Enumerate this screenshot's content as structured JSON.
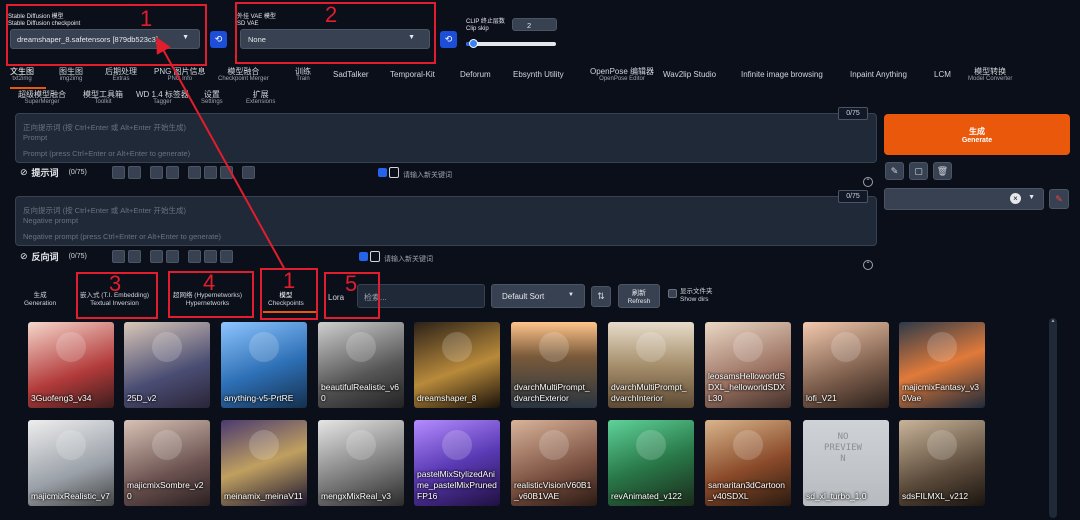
{
  "top": {
    "sd_model_label": "Stable Diffusion 模型",
    "sd_model_sublabel": "Stable Diffusion checkpoint",
    "sd_model_value": "dreamshaper_8.safetensors [879db523c3]",
    "vae_label": "外挂 VAE 模型",
    "vae_sublabel": "SD VAE",
    "vae_value": "None",
    "clip_label": "CLIP 终止层数",
    "clip_sublabel": "Clip skip",
    "clip_value": "2",
    "clip_fraction": 0.08
  },
  "tabs_row1": [
    {
      "label": "文生图",
      "sub": "txt2img"
    },
    {
      "label": "图生图",
      "sub": "img2img"
    },
    {
      "label": "后期处理",
      "sub": "Extras"
    },
    {
      "label": "PNG 图片信息",
      "sub": "PNG Info"
    },
    {
      "label": "模型融合",
      "sub": "Checkpoint Merger"
    },
    {
      "label": "训练",
      "sub": "Train"
    },
    {
      "label": "SadTalker",
      "sub": ""
    },
    {
      "label": "Temporal-Kit",
      "sub": ""
    },
    {
      "label": "Deforum",
      "sub": ""
    },
    {
      "label": "Ebsynth Utility",
      "sub": ""
    },
    {
      "label": "OpenPose 编辑器",
      "sub": "OpenPose Editor"
    },
    {
      "label": "Wav2lip Studio",
      "sub": ""
    },
    {
      "label": "Infinite image browsing",
      "sub": ""
    },
    {
      "label": "Inpaint Anything",
      "sub": ""
    },
    {
      "label": "LCM",
      "sub": ""
    },
    {
      "label": "模型转换",
      "sub": "Model Converter"
    }
  ],
  "tabs_row2": [
    {
      "label": "超级模型融合",
      "sub": "SuperMerger"
    },
    {
      "label": "模型工具箱",
      "sub": "Toolkit"
    },
    {
      "label": "WD 1.4 标签器",
      "sub": "Tagger"
    },
    {
      "label": "设置",
      "sub": "Settings"
    },
    {
      "label": "扩展",
      "sub": "Extensions"
    }
  ],
  "prompt": {
    "counter": "0/75",
    "placeholder_1": "正向提示词 (按 Ctrl+Enter 或 Alt+Enter 开始生成)",
    "placeholder_2": "Prompt",
    "placeholder_3": "Prompt (press Ctrl+Enter or Alt+Enter to generate)",
    "toolbar_label": "提示词",
    "toolbar_count": "(0/75)",
    "keyword_placeholder": "请输入新关键词"
  },
  "negative": {
    "counter": "0/75",
    "placeholder_1": "反向提示词 (按 Ctrl+Enter 或 Alt+Enter 开始生成)",
    "placeholder_2": "Negative prompt",
    "placeholder_3": "Negative prompt (press Ctrl+Enter or Alt+Enter to generate)",
    "toolbar_label": "反向词",
    "toolbar_count": "(0/75)",
    "keyword_placeholder": "请输入新关键词"
  },
  "generate": {
    "label": "生成",
    "sub": "Generate"
  },
  "extra_tabs": [
    {
      "label": "生成",
      "sub": "Generation"
    },
    {
      "label": "嵌入式 (T.I. Embedding)",
      "sub": "Textual Inversion"
    },
    {
      "label": "超网络 (Hypernetworks)",
      "sub": "Hypernetworks"
    },
    {
      "label": "模型",
      "sub": "Checkpoints"
    },
    {
      "label": "Lora",
      "sub": ""
    }
  ],
  "search_placeholder": "检索...",
  "sort_value": "Default Sort",
  "refresh": {
    "label": "刷新",
    "sub": "Refresh"
  },
  "show_dirs": {
    "label": "显示文件夹",
    "sub": "Show dirs"
  },
  "annotations": [
    "1",
    "2",
    "1",
    "3",
    "4",
    "5"
  ],
  "cards_row1": [
    "3Guofeng3_v34",
    "25D_v2",
    "anything-v5-PrtRE",
    "beautifulRealistic_v60",
    "dreamshaper_8",
    "dvarchMultiPrompt_dvarchExterior",
    "dvarchMultiPrompt_dvarchInterior",
    "leosamsHelloworldSDXL_helloworldSDXL30",
    "lofi_V21",
    "majicmixFantasy_v30Vae"
  ],
  "cards_row2": [
    "majicmixRealistic_v7",
    "majicmixSombre_v20",
    "meinamix_meinaV11",
    "mengxMixReal_v3",
    "pastelMixStylizedAnime_pastelMixPrunedFP16",
    "realisticVisionV60B1_v60B1VAE",
    "revAnimated_v122",
    "samaritan3dCartoon_v40SDXL",
    "sd_xl_turbo_1.0",
    "sdsFILMXL_v212"
  ],
  "noprev": [
    "NO",
    "PREVIEW",
    "N"
  ],
  "colors": {
    "accent": "#ea580c",
    "annotation": "#e11d2e",
    "bg": "#0b0f19"
  }
}
